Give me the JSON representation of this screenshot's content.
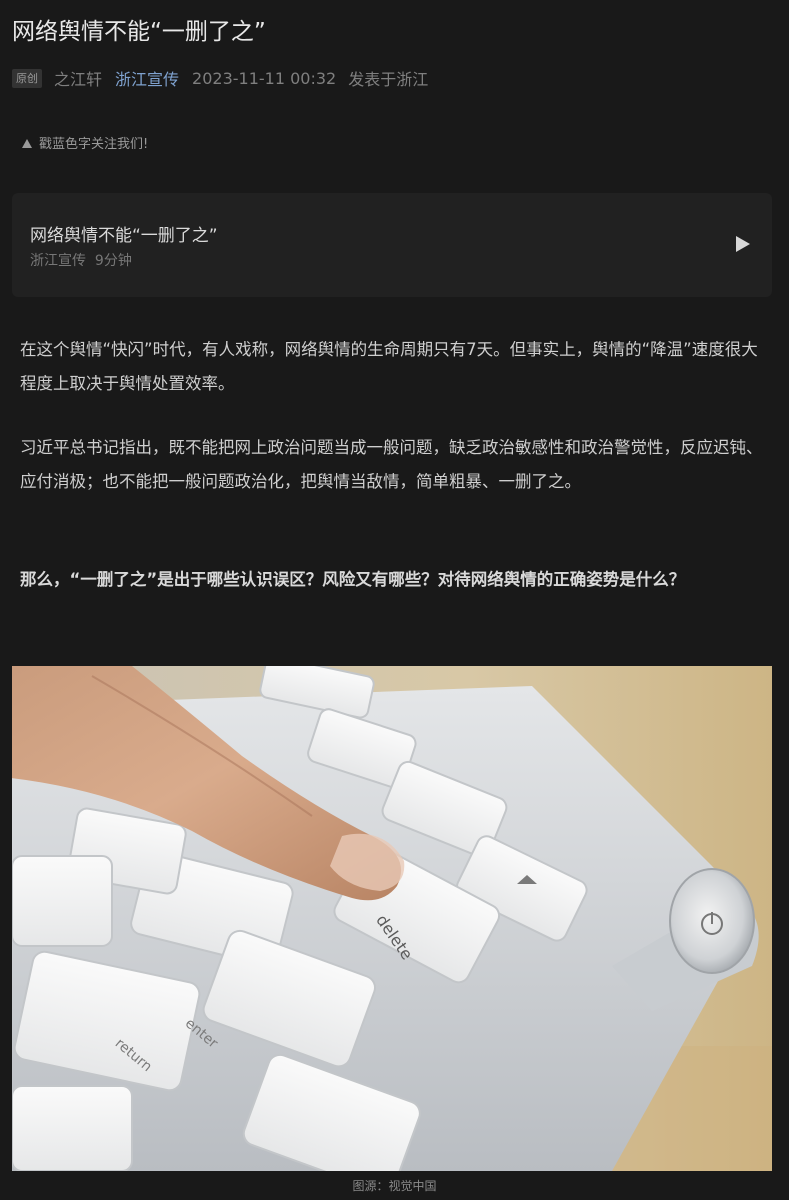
{
  "article": {
    "title": "网络舆情不能“一删了之”",
    "badge": "原创",
    "author": "之江轩",
    "account": "浙江宣传",
    "datetime": "2023-11-11 00:32",
    "location": "发表于浙江"
  },
  "follow_prompt": "戳蓝色字关注我们!",
  "audio_card": {
    "title": "网络舆情不能“一删了之”",
    "source": "浙江宣传",
    "duration": "9分钟",
    "icon": "play-icon"
  },
  "paragraphs": {
    "p1": "在这个舆情“快闪”时代，有人戏称，网络舆情的生命周期只有7天。但事实上，舆情的“降温”速度很大程度上取决于舆情处置效率。",
    "p2": "习近平总书记指出，既不能把网上政治问题当成一般问题，缺乏政治敏感性和政治警觉性，反应迟钝、应付消极；也不能把一般问题政治化，把舆情当敌情，简单粗暴、一删了之。",
    "p3": "那么，“一删了之”是出于哪些认识误区？风险又有哪些？对待网络舆情的正确姿势是什么？"
  },
  "image": {
    "key_label": "delete",
    "return_label": "return",
    "enter_label": "enter",
    "caption": "图源：视觉中国"
  },
  "colors": {
    "background": "#191919",
    "account_link": "#7fa2cf",
    "card": "#212121"
  }
}
